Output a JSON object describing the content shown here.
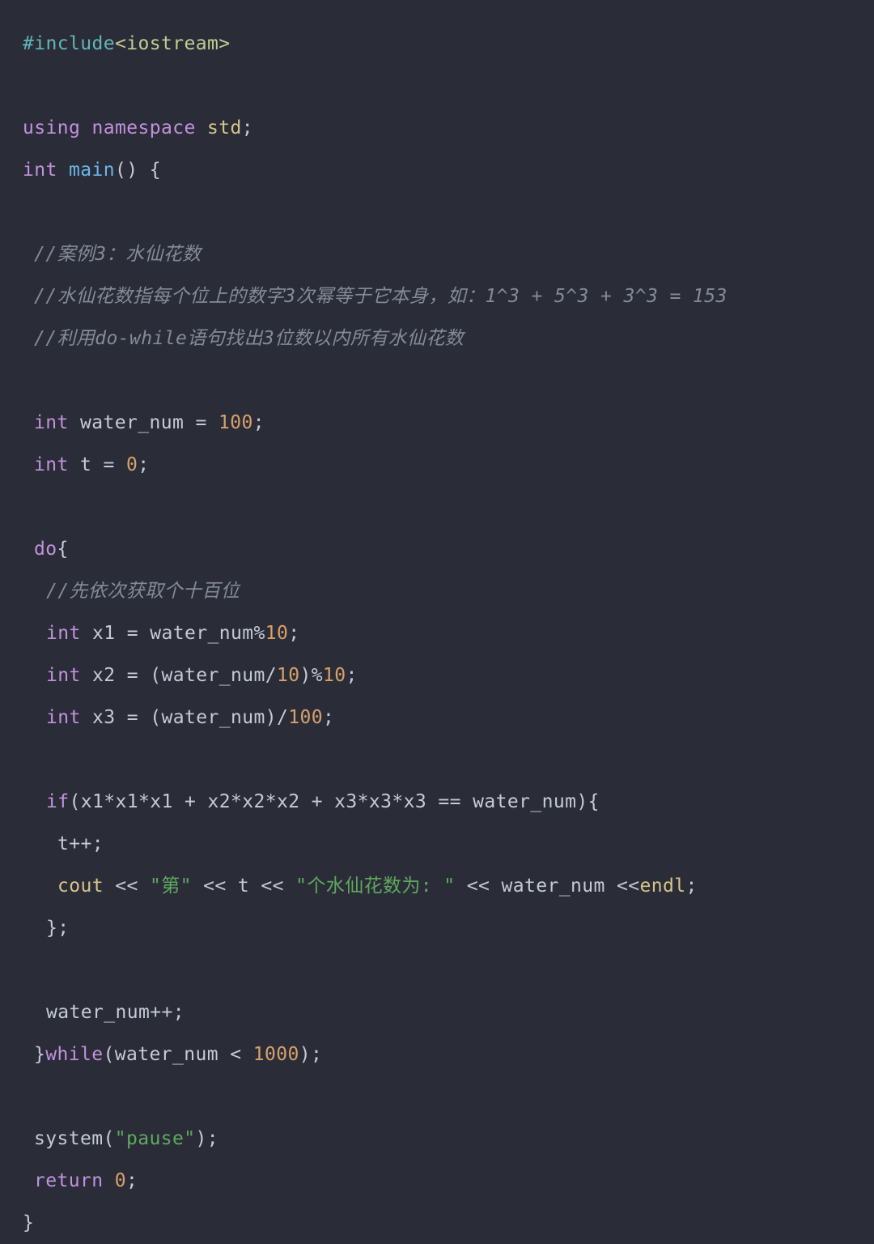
{
  "editor": {
    "language": "cpp",
    "background": "#2a2d38",
    "colors": {
      "keyword": "#c191dd",
      "preprocessor": "#64b5b5",
      "header": "#c3cc8e",
      "function": "#6cb6e8",
      "namespace_member": "#d6c48a",
      "number": "#d8a06a",
      "string": "#5fa85f",
      "identifier": "#c5cad6",
      "comment": "#848a99"
    }
  },
  "code": {
    "l01": {
      "pre": "#include",
      "hdr": "<iostream>"
    },
    "l02": "",
    "l03": {
      "kw": "using namespace ",
      "std": "std",
      "end": ";"
    },
    "l04": {
      "kw": "int ",
      "fn": "main",
      "rest": "() {"
    },
    "l05": "",
    "l06": "//案例3：水仙花数",
    "l07": "//水仙花数指每个位上的数字3次幂等于它本身，如：1^3 + 5^3 + 3^3 = 153",
    "l08": "//利用do-while语句找出3位数以内所有水仙花数",
    "l09": "",
    "l10": {
      "kw": "int ",
      "ident": "water_num = ",
      "num": "100",
      "end": ";"
    },
    "l11": {
      "kw": "int ",
      "ident": "t = ",
      "num": "0",
      "end": ";"
    },
    "l12": "",
    "l13": {
      "kw": "do",
      "rest": "{"
    },
    "l14": "//先依次获取个十百位",
    "l15": {
      "kw": "int ",
      "ident": "x1 = water_num%",
      "num": "10",
      "end": ";"
    },
    "l16": {
      "kw": "int ",
      "ident": "x2 = (water_num/",
      "num": "10",
      "mid": ")%",
      "num2": "10",
      "end": ";"
    },
    "l17": {
      "kw": "int ",
      "ident": "x3 = (water_num)/",
      "num": "100",
      "end": ";"
    },
    "l18": "",
    "l19": {
      "kw": "if",
      "rest": "(x1*x1*x1 + x2*x2*x2 + x3*x3*x3 == water_num){"
    },
    "l20": "t++;",
    "l21": {
      "cout": "cout",
      "op1": " << ",
      "str1": "\"第\"",
      "op2": " << t << ",
      "str2": "\"个水仙花数为: \"",
      "op3": " << water_num <<",
      "endl": "endl",
      "end": ";"
    },
    "l22": "};",
    "l23": "",
    "l24": "water_num++;",
    "l25": {
      "brace": "}",
      "kw": "while",
      "ident": "(water_num < ",
      "num": "1000",
      "end": ");"
    },
    "l26": "",
    "l27": {
      "ident": "system(",
      "str": "\"pause\"",
      "end": ");"
    },
    "l28": {
      "kw": "return ",
      "num": "0",
      "end": ";"
    },
    "l29": "}"
  }
}
